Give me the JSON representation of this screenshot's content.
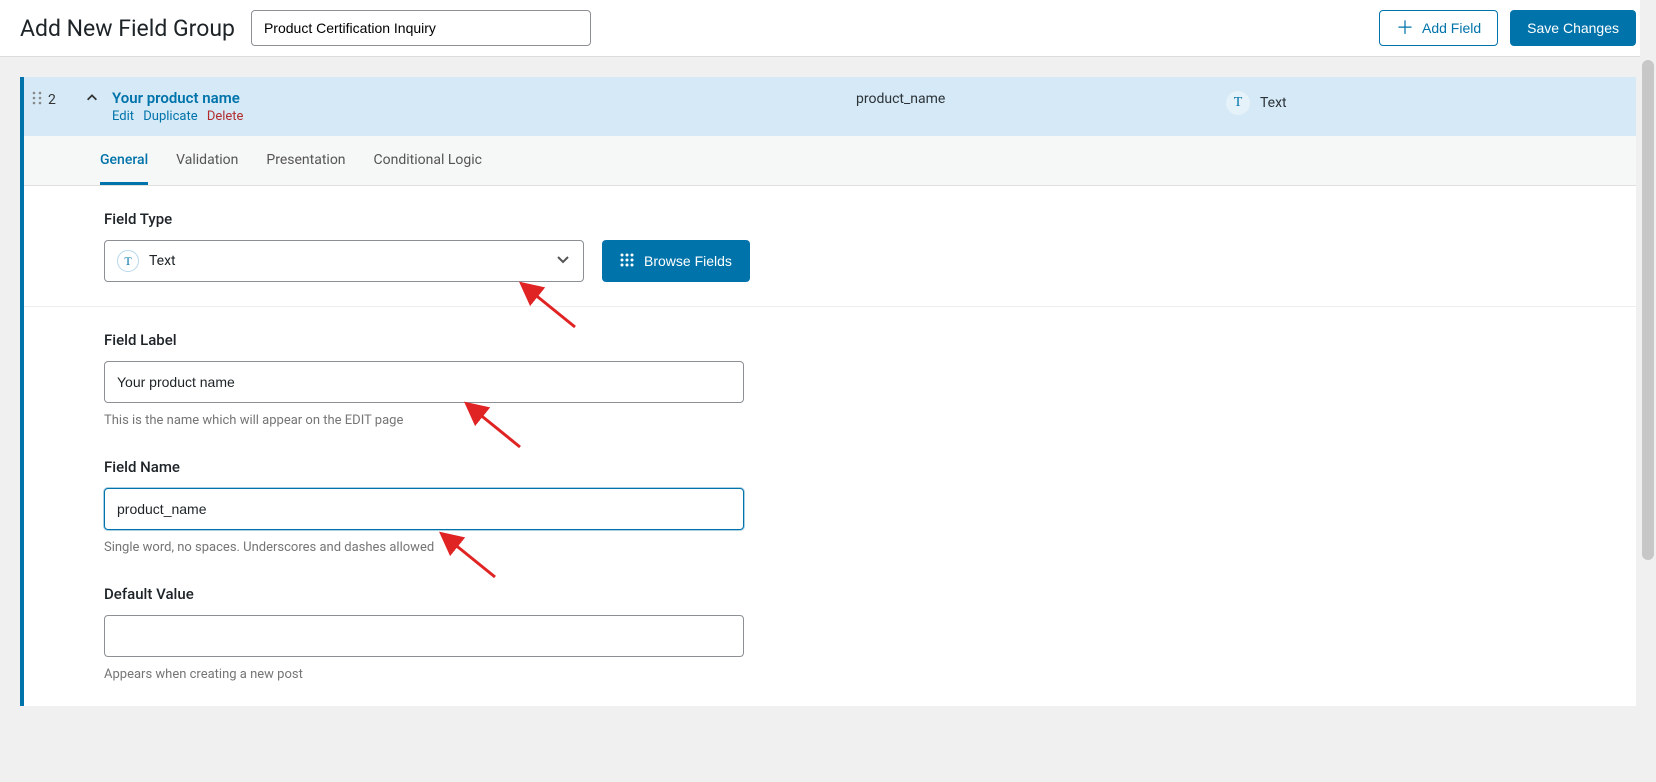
{
  "header": {
    "title": "Add New Field Group",
    "group_name": "Product Certification Inquiry",
    "add_field_label": "Add Field",
    "save_label": "Save Changes"
  },
  "field_row": {
    "index": "2",
    "label": "Your product name",
    "name": "product_name",
    "type": "Text",
    "type_icon": "T",
    "actions": {
      "edit": "Edit",
      "duplicate": "Duplicate",
      "delete": "Delete"
    }
  },
  "tabs": [
    {
      "id": "general",
      "label": "General",
      "active": true
    },
    {
      "id": "validation",
      "label": "Validation",
      "active": false
    },
    {
      "id": "presentation",
      "label": "Presentation",
      "active": false
    },
    {
      "id": "conditional",
      "label": "Conditional Logic",
      "active": false
    }
  ],
  "field_type": {
    "label": "Field Type",
    "selected": "Text",
    "icon": "T",
    "browse_label": "Browse Fields"
  },
  "field_label": {
    "label": "Field Label",
    "value": "Your product name",
    "help": "This is the name which will appear on the EDIT page"
  },
  "field_name": {
    "label": "Field Name",
    "value": "product_name",
    "help": "Single word, no spaces. Underscores and dashes allowed"
  },
  "default_value": {
    "label": "Default Value",
    "value": "",
    "help": "Appears when creating a new post"
  }
}
